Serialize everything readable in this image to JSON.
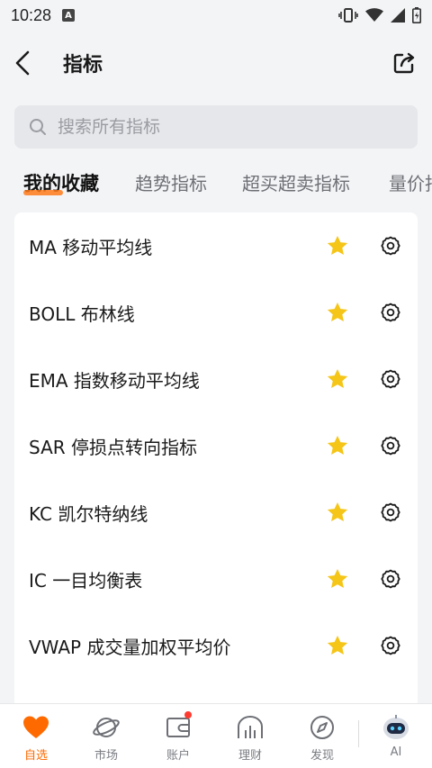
{
  "status_bar": {
    "time": "10:28",
    "notification_badge": "A"
  },
  "header": {
    "title": "指标"
  },
  "search": {
    "placeholder": "搜索所有指标"
  },
  "tabs": [
    {
      "label": "我的收藏",
      "active": true
    },
    {
      "label": "趋势指标",
      "active": false
    },
    {
      "label": "超买超卖指标",
      "active": false
    },
    {
      "label": "量价指标",
      "active": false
    }
  ],
  "indicators": [
    {
      "label": "MA 移动平均线",
      "favorite": true
    },
    {
      "label": "BOLL 布林线",
      "favorite": true
    },
    {
      "label": "EMA 指数移动平均线",
      "favorite": true
    },
    {
      "label": "SAR 停损点转向指标",
      "favorite": true
    },
    {
      "label": "KC 凯尔特纳线",
      "favorite": true
    },
    {
      "label": "IC 一目均衡表",
      "favorite": true
    },
    {
      "label": "VWAP 成交量加权平均价",
      "favorite": true
    }
  ],
  "bottom_nav": [
    {
      "label": "自选",
      "icon": "heart-icon",
      "active": true
    },
    {
      "label": "市场",
      "icon": "planet-icon",
      "active": false
    },
    {
      "label": "账户",
      "icon": "wallet-icon",
      "active": false,
      "badge": true
    },
    {
      "label": "理财",
      "icon": "finance-icon",
      "active": false
    },
    {
      "label": "发现",
      "icon": "compass-icon",
      "active": false
    },
    {
      "label": "AI",
      "icon": "robot-icon",
      "active": false
    }
  ],
  "colors": {
    "accent": "#ff6a00",
    "star": "#f5c518",
    "badge": "#ff3b30"
  }
}
